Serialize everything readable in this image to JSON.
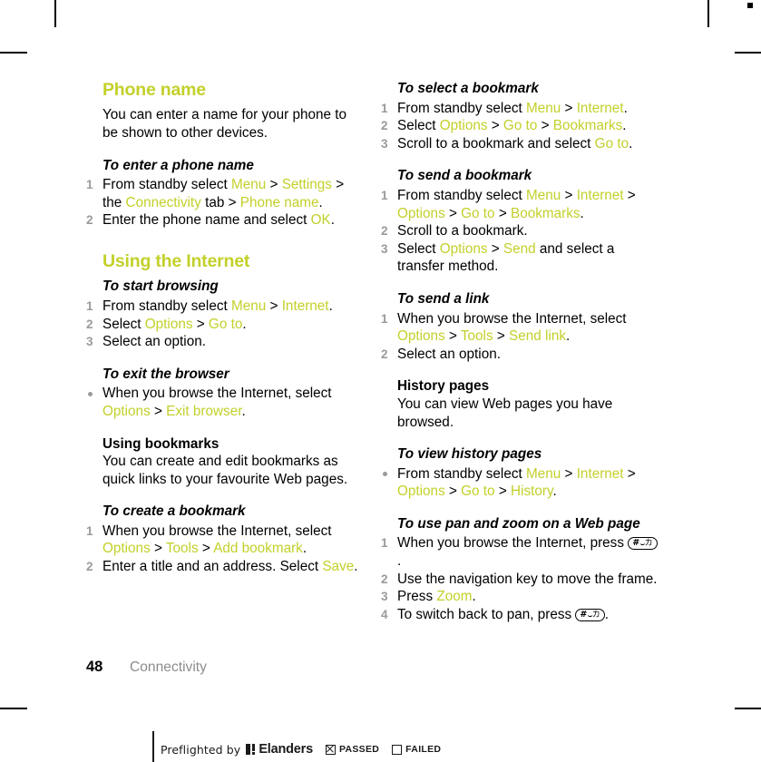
{
  "document": {
    "page_number": "48",
    "chapter": "Connectivity"
  },
  "left_column": {
    "section1": {
      "heading": "Phone name",
      "intro": "You can enter a name for your phone to be shown to other devices.",
      "task1": {
        "title": "To enter a phone name",
        "steps": [
          {
            "n": "1",
            "parts": [
              {
                "t": "From standby select ",
                "kw": false
              },
              {
                "t": "Menu",
                "kw": true
              },
              {
                "t": " > ",
                "kw": false
              },
              {
                "t": "Settings",
                "kw": true
              },
              {
                "t": " > the ",
                "kw": false
              },
              {
                "t": "Connectivity",
                "kw": true
              },
              {
                "t": " tab > ",
                "kw": false
              },
              {
                "t": "Phone name",
                "kw": true
              },
              {
                "t": ".",
                "kw": false
              }
            ]
          },
          {
            "n": "2",
            "parts": [
              {
                "t": "Enter the phone name and select ",
                "kw": false
              },
              {
                "t": "OK",
                "kw": true
              },
              {
                "t": ".",
                "kw": false
              }
            ]
          }
        ]
      }
    },
    "section2": {
      "heading": "Using the Internet",
      "task_start": {
        "title": "To start browsing",
        "steps": [
          {
            "n": "1",
            "parts": [
              {
                "t": "From standby select ",
                "kw": false
              },
              {
                "t": "Menu",
                "kw": true
              },
              {
                "t": " > ",
                "kw": false
              },
              {
                "t": "Internet",
                "kw": true
              },
              {
                "t": ".",
                "kw": false
              }
            ]
          },
          {
            "n": "2",
            "parts": [
              {
                "t": "Select ",
                "kw": false
              },
              {
                "t": "Options",
                "kw": true
              },
              {
                "t": " > ",
                "kw": false
              },
              {
                "t": "Go to",
                "kw": true
              },
              {
                "t": ".",
                "kw": false
              }
            ]
          },
          {
            "n": "3",
            "parts": [
              {
                "t": "Select an option.",
                "kw": false
              }
            ]
          }
        ]
      },
      "task_exit": {
        "title": "To exit the browser",
        "bullets": [
          {
            "parts": [
              {
                "t": "When you browse the Internet, select ",
                "kw": false
              },
              {
                "t": "Options",
                "kw": true
              },
              {
                "t": " > ",
                "kw": false
              },
              {
                "t": "Exit browser",
                "kw": true
              },
              {
                "t": ".",
                "kw": false
              }
            ]
          }
        ]
      },
      "subhead_bookmarks": {
        "title": "Using bookmarks",
        "text": "You can create and edit bookmarks as quick links to your favourite Web pages."
      },
      "task_create": {
        "title": "To create a bookmark",
        "steps": [
          {
            "n": "1",
            "parts": [
              {
                "t": "When you browse the Internet, select ",
                "kw": false
              },
              {
                "t": "Options",
                "kw": true
              },
              {
                "t": " > ",
                "kw": false
              },
              {
                "t": "Tools",
                "kw": true
              },
              {
                "t": " > ",
                "kw": false
              },
              {
                "t": "Add bookmark",
                "kw": true
              },
              {
                "t": ".",
                "kw": false
              }
            ]
          },
          {
            "n": "2",
            "parts": [
              {
                "t": "Enter a title and an address. Select ",
                "kw": false
              },
              {
                "t": "Save",
                "kw": true
              },
              {
                "t": ".",
                "kw": false
              }
            ]
          }
        ]
      }
    }
  },
  "right_column": {
    "task_select": {
      "title": "To select a bookmark",
      "steps": [
        {
          "n": "1",
          "parts": [
            {
              "t": "From standby select ",
              "kw": false
            },
            {
              "t": "Menu",
              "kw": true
            },
            {
              "t": " > ",
              "kw": false
            },
            {
              "t": "Internet",
              "kw": true
            },
            {
              "t": ".",
              "kw": false
            }
          ]
        },
        {
          "n": "2",
          "parts": [
            {
              "t": "Select ",
              "kw": false
            },
            {
              "t": "Options",
              "kw": true
            },
            {
              "t": " > ",
              "kw": false
            },
            {
              "t": "Go to",
              "kw": true
            },
            {
              "t": " > ",
              "kw": false
            },
            {
              "t": "Bookmarks",
              "kw": true
            },
            {
              "t": ".",
              "kw": false
            }
          ]
        },
        {
          "n": "3",
          "parts": [
            {
              "t": "Scroll to a bookmark and select ",
              "kw": false
            },
            {
              "t": "Go to",
              "kw": true
            },
            {
              "t": ".",
              "kw": false
            }
          ]
        }
      ]
    },
    "task_send_bookmark": {
      "title": "To send a bookmark",
      "steps": [
        {
          "n": "1",
          "parts": [
            {
              "t": "From standby select ",
              "kw": false
            },
            {
              "t": "Menu",
              "kw": true
            },
            {
              "t": " > ",
              "kw": false
            },
            {
              "t": "Internet",
              "kw": true
            },
            {
              "t": " > ",
              "kw": false
            },
            {
              "t": "Options",
              "kw": true
            },
            {
              "t": " > ",
              "kw": false
            },
            {
              "t": "Go to",
              "kw": true
            },
            {
              "t": " > ",
              "kw": false
            },
            {
              "t": "Bookmarks",
              "kw": true
            },
            {
              "t": ".",
              "kw": false
            }
          ]
        },
        {
          "n": "2",
          "parts": [
            {
              "t": "Scroll to a bookmark.",
              "kw": false
            }
          ]
        },
        {
          "n": "3",
          "parts": [
            {
              "t": "Select ",
              "kw": false
            },
            {
              "t": "Options",
              "kw": true
            },
            {
              "t": " > ",
              "kw": false
            },
            {
              "t": "Send",
              "kw": true
            },
            {
              "t": " and select a transfer method.",
              "kw": false
            }
          ]
        }
      ]
    },
    "task_send_link": {
      "title": "To send a link",
      "steps": [
        {
          "n": "1",
          "parts": [
            {
              "t": "When you browse the Internet, select ",
              "kw": false
            },
            {
              "t": "Options",
              "kw": true
            },
            {
              "t": " > ",
              "kw": false
            },
            {
              "t": "Tools",
              "kw": true
            },
            {
              "t": " > ",
              "kw": false
            },
            {
              "t": "Send link",
              "kw": true
            },
            {
              "t": ".",
              "kw": false
            }
          ]
        },
        {
          "n": "2",
          "parts": [
            {
              "t": "Select an option.",
              "kw": false
            }
          ]
        }
      ]
    },
    "subhead_history": {
      "title": "History pages",
      "text": "You can view Web pages you have browsed."
    },
    "task_view_history": {
      "title": "To view history pages",
      "bullets": [
        {
          "parts": [
            {
              "t": "From standby select ",
              "kw": false
            },
            {
              "t": "Menu",
              "kw": true
            },
            {
              "t": " > ",
              "kw": false
            },
            {
              "t": "Internet",
              "kw": true
            },
            {
              "t": " > ",
              "kw": false
            },
            {
              "t": "Options",
              "kw": true
            },
            {
              "t": " > ",
              "kw": false
            },
            {
              "t": "Go to",
              "kw": true
            },
            {
              "t": " > ",
              "kw": false
            },
            {
              "t": "History",
              "kw": true
            },
            {
              "t": ".",
              "kw": false
            }
          ]
        }
      ]
    },
    "task_pan_zoom": {
      "title": "To use pan and zoom on a Web page",
      "steps": [
        {
          "n": "1",
          "parts": [
            {
              "t": "When you browse the Internet, press ",
              "kw": false
            },
            {
              "key": true
            },
            {
              "t": ".",
              "kw": false
            }
          ]
        },
        {
          "n": "2",
          "parts": [
            {
              "t": "Use the navigation key to move the frame.",
              "kw": false
            }
          ]
        },
        {
          "n": "3",
          "parts": [
            {
              "t": "Press ",
              "kw": false
            },
            {
              "t": "Zoom",
              "kw": true
            },
            {
              "t": ".",
              "kw": false
            }
          ]
        },
        {
          "n": "4",
          "parts": [
            {
              "t": "To switch back to pan, press ",
              "kw": false
            },
            {
              "key": true
            },
            {
              "t": ".",
              "kw": false
            }
          ]
        }
      ]
    }
  },
  "keycap": {
    "hash": "#",
    "dash": "⌣",
    "kana": "カ"
  },
  "preflight": {
    "text": "Preflighted by",
    "brand": "Elanders",
    "passed_label": "PASSED",
    "failed_label": "FAILED",
    "passed_checked": true,
    "failed_checked": false
  },
  "colors": {
    "accent_green": "#c3d02a",
    "step_number_gray": "#9a9a9a",
    "chapter_gray": "#8c8c8c"
  }
}
